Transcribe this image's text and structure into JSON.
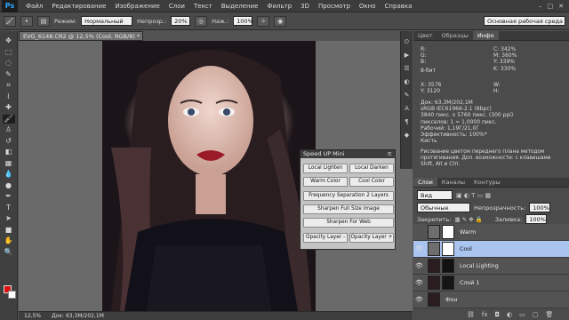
{
  "app": {
    "logo": "Ps"
  },
  "menu": [
    "Файл",
    "Редактирование",
    "Изображение",
    "Слои",
    "Текст",
    "Выделение",
    "Фильтр",
    "3D",
    "Просмотр",
    "Окно",
    "Справка"
  ],
  "options": {
    "mode_label": "Режим:",
    "mode_value": "Нормальный",
    "opacity_label": "Непрозр.:",
    "opacity_value": "20%",
    "pressure_label": "Наж.:",
    "pressure_value": "100%",
    "workspace": "Основная рабочая среда"
  },
  "document": {
    "tab_title": "EVG_6148.CR2 @ 12,5% (Cool, RGB/8) *"
  },
  "status": {
    "zoom": "12,5%",
    "doc": "Док: 63,3M/202,1M"
  },
  "tools": [
    "move-icon",
    "marquee-icon",
    "lasso-icon",
    "quick-select-icon",
    "crop-icon",
    "eyedropper-icon",
    "healing-icon",
    "brush-icon",
    "stamp-icon",
    "history-brush-icon",
    "eraser-icon",
    "gradient-icon",
    "blur-icon",
    "dodge-icon",
    "pen-icon",
    "type-icon",
    "path-select-icon",
    "shape-icon",
    "hand-icon",
    "zoom-icon"
  ],
  "tool_glyphs": [
    "✥",
    "⬚",
    "◌",
    "✎",
    "⌗",
    "⌇",
    "✚",
    "🖌",
    "♙",
    "↺",
    "◧",
    "▦",
    "💧",
    "●",
    "✒",
    "T",
    "➤",
    "■",
    "✋",
    "🔍"
  ],
  "top_panel": {
    "tabs": [
      "Цвет",
      "Образцы",
      "Инфо"
    ],
    "active_tab": "Инфо",
    "info": {
      "r_label": "R:",
      "g_label": "G:",
      "b_label": "B:",
      "bits": "8-бит",
      "c_label": "C:",
      "m_label": "M:",
      "y_label": "Y:",
      "k_label": "K:",
      "c_val": "342%",
      "m_val": "360%",
      "y_val": "339%",
      "k_val": "330%",
      "x_label": "X:",
      "y2_label": "Y:",
      "x_val": "3576",
      "y2_val": "3120",
      "w_label": "W:",
      "h_label": "H:",
      "lines": [
        "Док: 63,3M/202,1M",
        "sRGB IEC61966-2.1 (8bpc)",
        "3840 пикс. x 5760 пикс. (300 ppi)",
        "пикселов: 1 = 1,0000 пикс.",
        "Рабочий: 1,19Г/21,0Г",
        "Эффективность: 100%*",
        "Кисть"
      ],
      "hint": "Рисование цветом переднего плана методом протягивания. Доп. возможности: с клавишами Shift, Alt и Ctrl."
    }
  },
  "speed_panel": {
    "title": "Speed UP Mini",
    "buttons": {
      "local_lighten": "Local Lighten",
      "local_darken": "Local Darken",
      "warm": "Warm Color",
      "cool": "Cool Color",
      "freq": "Frequency Separation 2 Layers",
      "sharpen_full": "Sharpen Full Size Image",
      "sharpen_web": "Sharpen For Web",
      "opacity_minus": "Opacity Layer -",
      "opacity_plus": "Opacity Layer +"
    }
  },
  "layers_panel": {
    "tabs": [
      "Слои",
      "Каналы",
      "Контуры"
    ],
    "active_tab": "Слои",
    "kind_label": "Вид",
    "blend": "Обычные",
    "opacity_label": "Непрозрачность:",
    "opacity": "100%",
    "lock_label": "Закрепить:",
    "fill_label": "Заливка:",
    "fill": "100%",
    "layers": [
      {
        "name": "Warm",
        "selected": false
      },
      {
        "name": "Cool",
        "selected": true
      },
      {
        "name": "Local Lighting",
        "selected": false
      },
      {
        "name": "Слой 1",
        "selected": false
      },
      {
        "name": "Фон",
        "selected": false
      }
    ]
  },
  "colors": {
    "foreground": "#e01010",
    "background": "#ffffff",
    "selection": "#aac4f0"
  }
}
